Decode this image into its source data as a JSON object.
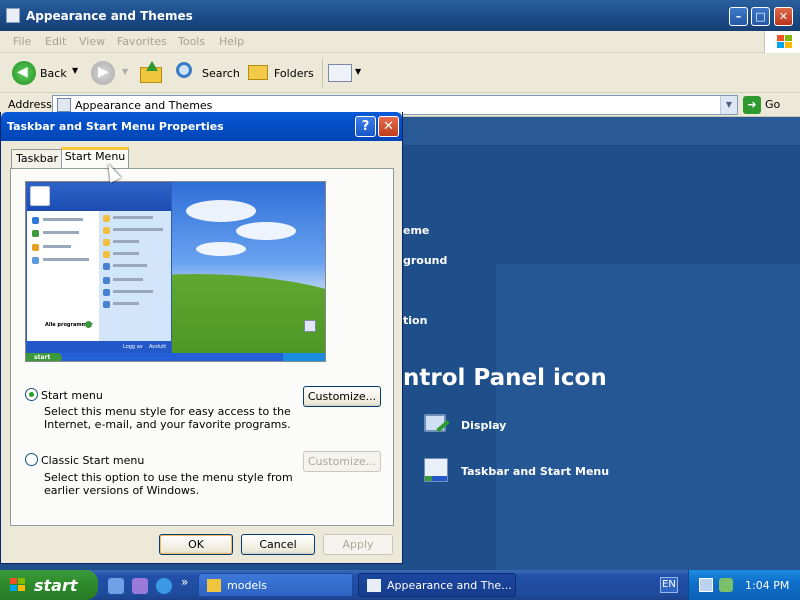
{
  "explorer": {
    "title": "Appearance and Themes",
    "menu": [
      "File",
      "Edit",
      "View",
      "Favorites",
      "Tools",
      "Help"
    ],
    "toolbar": {
      "back": "Back",
      "search": "Search",
      "folders": "Folders"
    },
    "address": {
      "label": "Address",
      "value": "Appearance and Themes",
      "go": "Go"
    },
    "content": {
      "frag_theme": "eme",
      "frag_background": "ground",
      "frag_resolution": "tion",
      "heading_fragment": "ntrol Panel icon",
      "icon_display": "Display",
      "icon_taskbar": "Taskbar and Start Menu"
    }
  },
  "dialog": {
    "title": "Taskbar and Start Menu Properties",
    "tabs": [
      "Taskbar",
      "Start Menu"
    ],
    "preview": {
      "start_label": "start",
      "all_programs": "Alle programmer",
      "logoff": "Logg av",
      "shutdown": "Avslutt"
    },
    "option_start": {
      "label": "Start menu",
      "desc": "Select this menu style for easy access to the Internet, e-mail, and your favorite programs.",
      "button": "Customize...",
      "selected": true
    },
    "option_classic": {
      "label": "Classic Start menu",
      "desc": "Select this option to use the menu style from earlier versions of Windows.",
      "button": "Customize...",
      "selected": false
    },
    "buttons": {
      "ok": "OK",
      "cancel": "Cancel",
      "apply": "Apply"
    }
  },
  "taskbar": {
    "start": "start",
    "chevron": "»",
    "items": [
      "models",
      "Appearance and The..."
    ],
    "language": "EN",
    "clock": "1:04 PM"
  },
  "icons": {
    "back": "back-arrow-icon",
    "forward": "forward-arrow-icon",
    "up": "folder-up-icon",
    "search": "magnifier-icon",
    "folders": "folders-icon",
    "views": "views-icon",
    "go": "go-arrow-icon",
    "help": "help-icon",
    "close": "close-icon"
  },
  "colors": {
    "titlebar_blue": "#0a5ad8",
    "close_red": "#b8341a",
    "start_green": "#2d8a2b",
    "desktop_blue": "#1e4f8a",
    "dialog_face": "#ece9d8",
    "tab_highlight": "#ffc83c"
  }
}
